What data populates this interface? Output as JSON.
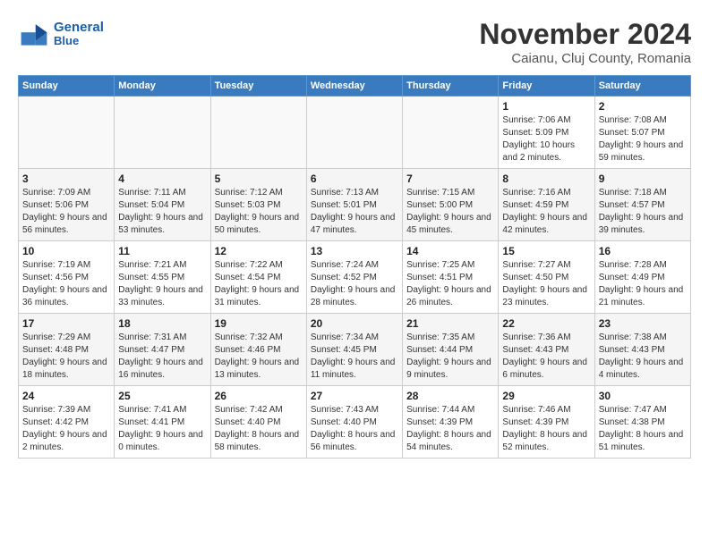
{
  "logo": {
    "line1": "General",
    "line2": "Blue"
  },
  "title": "November 2024",
  "subtitle": "Caianu, Cluj County, Romania",
  "weekdays": [
    "Sunday",
    "Monday",
    "Tuesday",
    "Wednesday",
    "Thursday",
    "Friday",
    "Saturday"
  ],
  "weeks": [
    [
      {
        "day": "",
        "info": ""
      },
      {
        "day": "",
        "info": ""
      },
      {
        "day": "",
        "info": ""
      },
      {
        "day": "",
        "info": ""
      },
      {
        "day": "",
        "info": ""
      },
      {
        "day": "1",
        "info": "Sunrise: 7:06 AM\nSunset: 5:09 PM\nDaylight: 10 hours and 2 minutes."
      },
      {
        "day": "2",
        "info": "Sunrise: 7:08 AM\nSunset: 5:07 PM\nDaylight: 9 hours and 59 minutes."
      }
    ],
    [
      {
        "day": "3",
        "info": "Sunrise: 7:09 AM\nSunset: 5:06 PM\nDaylight: 9 hours and 56 minutes."
      },
      {
        "day": "4",
        "info": "Sunrise: 7:11 AM\nSunset: 5:04 PM\nDaylight: 9 hours and 53 minutes."
      },
      {
        "day": "5",
        "info": "Sunrise: 7:12 AM\nSunset: 5:03 PM\nDaylight: 9 hours and 50 minutes."
      },
      {
        "day": "6",
        "info": "Sunrise: 7:13 AM\nSunset: 5:01 PM\nDaylight: 9 hours and 47 minutes."
      },
      {
        "day": "7",
        "info": "Sunrise: 7:15 AM\nSunset: 5:00 PM\nDaylight: 9 hours and 45 minutes."
      },
      {
        "day": "8",
        "info": "Sunrise: 7:16 AM\nSunset: 4:59 PM\nDaylight: 9 hours and 42 minutes."
      },
      {
        "day": "9",
        "info": "Sunrise: 7:18 AM\nSunset: 4:57 PM\nDaylight: 9 hours and 39 minutes."
      }
    ],
    [
      {
        "day": "10",
        "info": "Sunrise: 7:19 AM\nSunset: 4:56 PM\nDaylight: 9 hours and 36 minutes."
      },
      {
        "day": "11",
        "info": "Sunrise: 7:21 AM\nSunset: 4:55 PM\nDaylight: 9 hours and 33 minutes."
      },
      {
        "day": "12",
        "info": "Sunrise: 7:22 AM\nSunset: 4:54 PM\nDaylight: 9 hours and 31 minutes."
      },
      {
        "day": "13",
        "info": "Sunrise: 7:24 AM\nSunset: 4:52 PM\nDaylight: 9 hours and 28 minutes."
      },
      {
        "day": "14",
        "info": "Sunrise: 7:25 AM\nSunset: 4:51 PM\nDaylight: 9 hours and 26 minutes."
      },
      {
        "day": "15",
        "info": "Sunrise: 7:27 AM\nSunset: 4:50 PM\nDaylight: 9 hours and 23 minutes."
      },
      {
        "day": "16",
        "info": "Sunrise: 7:28 AM\nSunset: 4:49 PM\nDaylight: 9 hours and 21 minutes."
      }
    ],
    [
      {
        "day": "17",
        "info": "Sunrise: 7:29 AM\nSunset: 4:48 PM\nDaylight: 9 hours and 18 minutes."
      },
      {
        "day": "18",
        "info": "Sunrise: 7:31 AM\nSunset: 4:47 PM\nDaylight: 9 hours and 16 minutes."
      },
      {
        "day": "19",
        "info": "Sunrise: 7:32 AM\nSunset: 4:46 PM\nDaylight: 9 hours and 13 minutes."
      },
      {
        "day": "20",
        "info": "Sunrise: 7:34 AM\nSunset: 4:45 PM\nDaylight: 9 hours and 11 minutes."
      },
      {
        "day": "21",
        "info": "Sunrise: 7:35 AM\nSunset: 4:44 PM\nDaylight: 9 hours and 9 minutes."
      },
      {
        "day": "22",
        "info": "Sunrise: 7:36 AM\nSunset: 4:43 PM\nDaylight: 9 hours and 6 minutes."
      },
      {
        "day": "23",
        "info": "Sunrise: 7:38 AM\nSunset: 4:43 PM\nDaylight: 9 hours and 4 minutes."
      }
    ],
    [
      {
        "day": "24",
        "info": "Sunrise: 7:39 AM\nSunset: 4:42 PM\nDaylight: 9 hours and 2 minutes."
      },
      {
        "day": "25",
        "info": "Sunrise: 7:41 AM\nSunset: 4:41 PM\nDaylight: 9 hours and 0 minutes."
      },
      {
        "day": "26",
        "info": "Sunrise: 7:42 AM\nSunset: 4:40 PM\nDaylight: 8 hours and 58 minutes."
      },
      {
        "day": "27",
        "info": "Sunrise: 7:43 AM\nSunset: 4:40 PM\nDaylight: 8 hours and 56 minutes."
      },
      {
        "day": "28",
        "info": "Sunrise: 7:44 AM\nSunset: 4:39 PM\nDaylight: 8 hours and 54 minutes."
      },
      {
        "day": "29",
        "info": "Sunrise: 7:46 AM\nSunset: 4:39 PM\nDaylight: 8 hours and 52 minutes."
      },
      {
        "day": "30",
        "info": "Sunrise: 7:47 AM\nSunset: 4:38 PM\nDaylight: 8 hours and 51 minutes."
      }
    ]
  ]
}
